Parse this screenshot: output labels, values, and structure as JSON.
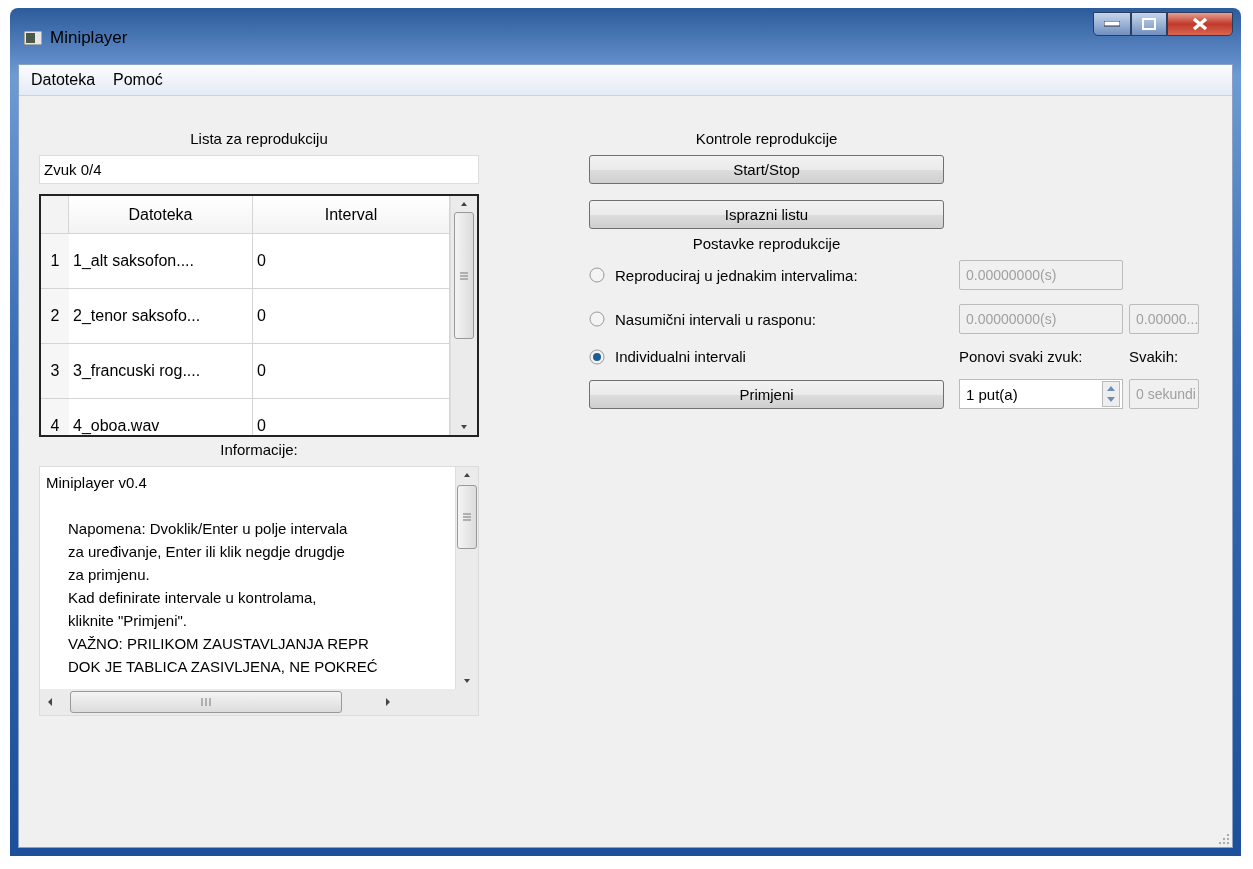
{
  "window": {
    "title": "Miniplayer"
  },
  "menu": [
    "Datoteka",
    "Pomoć"
  ],
  "playlist": {
    "title": "Lista za reprodukciju",
    "status": "Zvuk 0/4",
    "table": {
      "columns": [
        "Datoteka",
        "Interval"
      ],
      "rows": [
        {
          "number": "1",
          "file": "1_alt saksofon....",
          "interval": "0"
        },
        {
          "number": "2",
          "file": "2_tenor saksofo...",
          "interval": "0"
        },
        {
          "number": "3",
          "file": "3_francuski rog....",
          "interval": "0"
        },
        {
          "number": "4",
          "file": "4_oboa.wav",
          "interval": "0"
        }
      ]
    }
  },
  "info": {
    "title": "Informacije:",
    "lines": [
      {
        "kind": "heading",
        "text": "Miniplayer v0.4"
      },
      {
        "kind": "note",
        "text": "Napomena: Dvoklik/Enter u polje intervala"
      },
      {
        "kind": "note",
        "text": "za uređivanje, Enter ili klik negdje drugdje"
      },
      {
        "kind": "note",
        "text": "za primjenu."
      },
      {
        "kind": "note",
        "text": "Kad definirate intervale u kontrolama,"
      },
      {
        "kind": "note",
        "text": "kliknite \"Primjeni\"."
      },
      {
        "kind": "note",
        "text": "VAŽNO: PRILIKOM ZAUSTAVLJANJA REPR"
      },
      {
        "kind": "note",
        "text": "DOK JE TABLICA ZASIVLJENA, NE POKREĆ"
      }
    ]
  },
  "controls": {
    "title": "Kontrole reprodukcije",
    "buttons": [
      "Start/Stop",
      "Isprazni listu"
    ]
  },
  "settings": {
    "title": "Postavke reprodukcije",
    "options": [
      {
        "label": "Reproduciraj u jednakim intervalima:",
        "selected": false,
        "fields": [
          {
            "value": "0.00000000(s)",
            "disabled": true
          }
        ]
      },
      {
        "label": "Nasumični intervali u rasponu:",
        "selected": false,
        "fields": [
          {
            "value": "0.00000000(s)",
            "disabled": true
          },
          {
            "value": "0.00000...",
            "disabled": true
          }
        ]
      },
      {
        "label": "Individualni intervali",
        "selected": true
      }
    ],
    "repeat_label": "Ponovi svaki zvuk:",
    "every_label": "Svakih:",
    "apply_button": "Primjeni",
    "repeat_spin": {
      "value": "1 put(a)"
    },
    "every_field": {
      "value": "0 sekundi",
      "disabled": true
    }
  }
}
